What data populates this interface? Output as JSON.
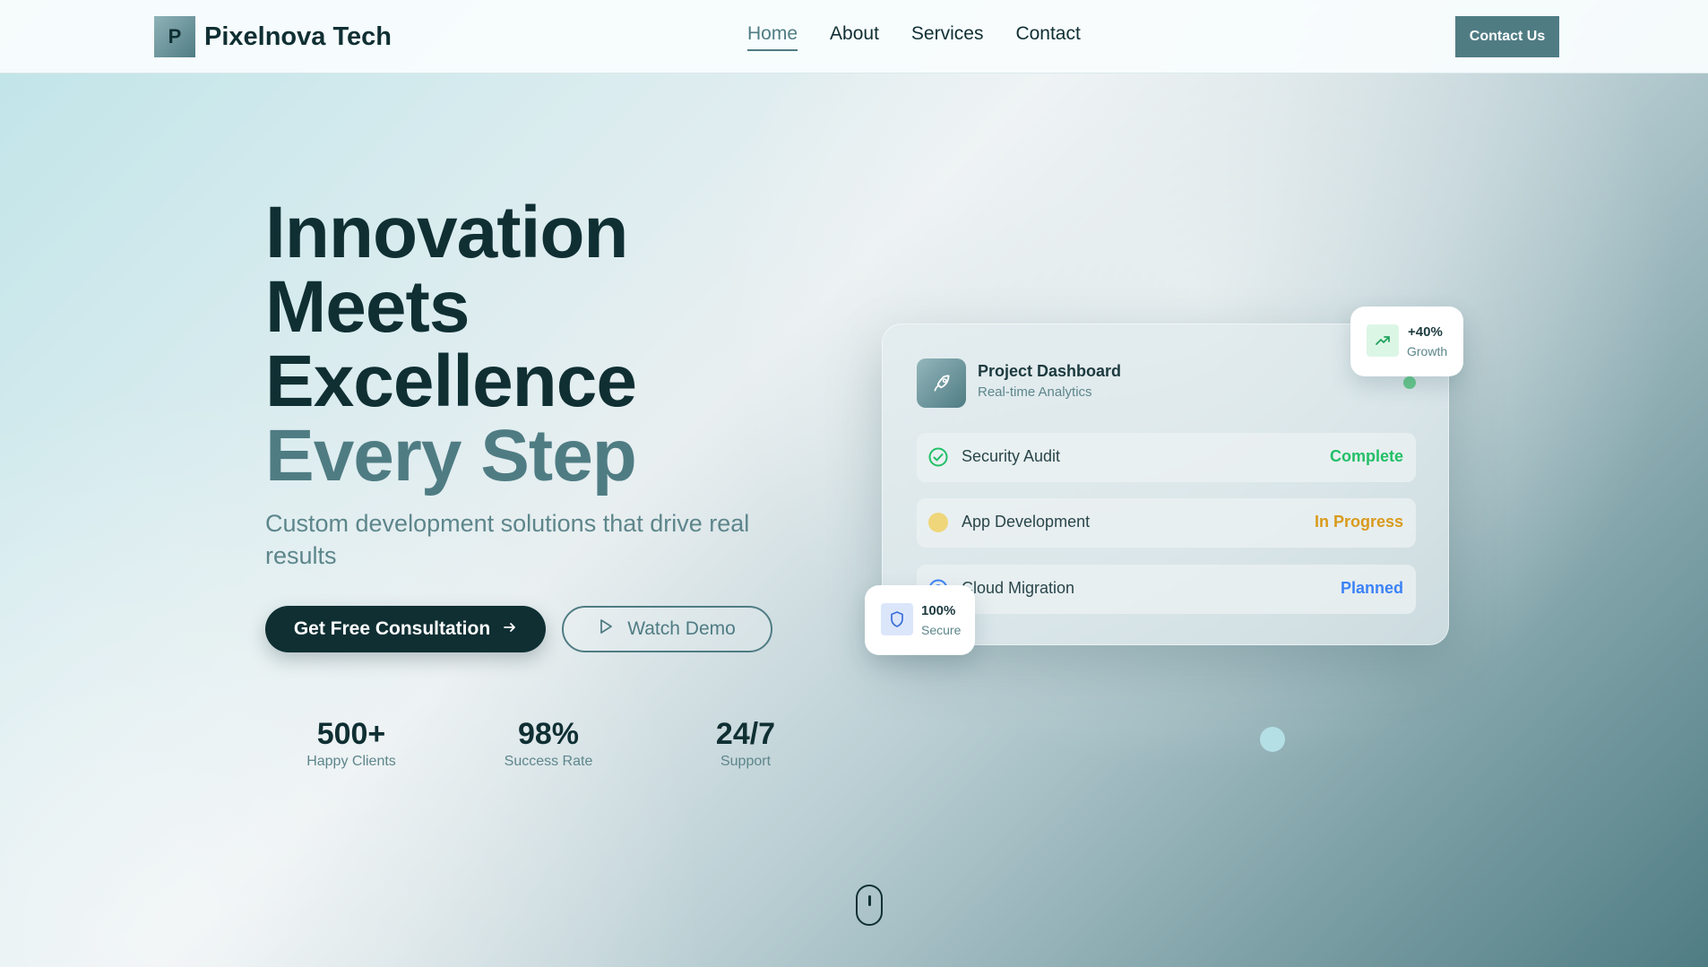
{
  "brand": {
    "logo_letter": "P",
    "name": "Pixelnova Tech"
  },
  "nav": {
    "links": [
      {
        "label": "Home",
        "active": true
      },
      {
        "label": "About"
      },
      {
        "label": "Services"
      },
      {
        "label": "Contact"
      }
    ],
    "cta_label": "Contact Us"
  },
  "hero": {
    "title_lines": [
      "Innovation",
      "Meets",
      "Excellence"
    ],
    "title_accent": "Every Step",
    "subtitle": "Custom development solutions that drive real results",
    "primary_button": "Get Free Consultation",
    "secondary_button": "Watch Demo"
  },
  "stats": [
    {
      "value": "500+",
      "label": "Happy Clients"
    },
    {
      "value": "98%",
      "label": "Success Rate"
    },
    {
      "value": "24/7",
      "label": "Support"
    }
  ],
  "dashboard": {
    "icon": "rocket-icon",
    "title": "Project Dashboard",
    "subtitle": "Real-time Analytics",
    "tasks": [
      {
        "name": "Security Audit",
        "status": "Complete",
        "status_color": "#22c067",
        "icon": "check-circle-icon"
      },
      {
        "name": "App Development",
        "status": "In Progress",
        "status_color": "#d99a1c",
        "icon": "yellow-dot-icon"
      },
      {
        "name": "Cloud Migration",
        "status": "Planned",
        "status_color": "#3b82f6",
        "icon": "target-icon"
      }
    ]
  },
  "badges": {
    "growth": {
      "value": "+40%",
      "label": "Growth",
      "icon": "trending-up-icon"
    },
    "secure": {
      "value": "100%",
      "label": "Secure",
      "icon": "shield-icon"
    }
  },
  "colors": {
    "primary_dark": "#0f2f33",
    "accent": "#4f7c83",
    "muted_text": "#5d868b",
    "success": "#22c067",
    "warning": "#d99a1c",
    "info": "#3b82f6"
  }
}
